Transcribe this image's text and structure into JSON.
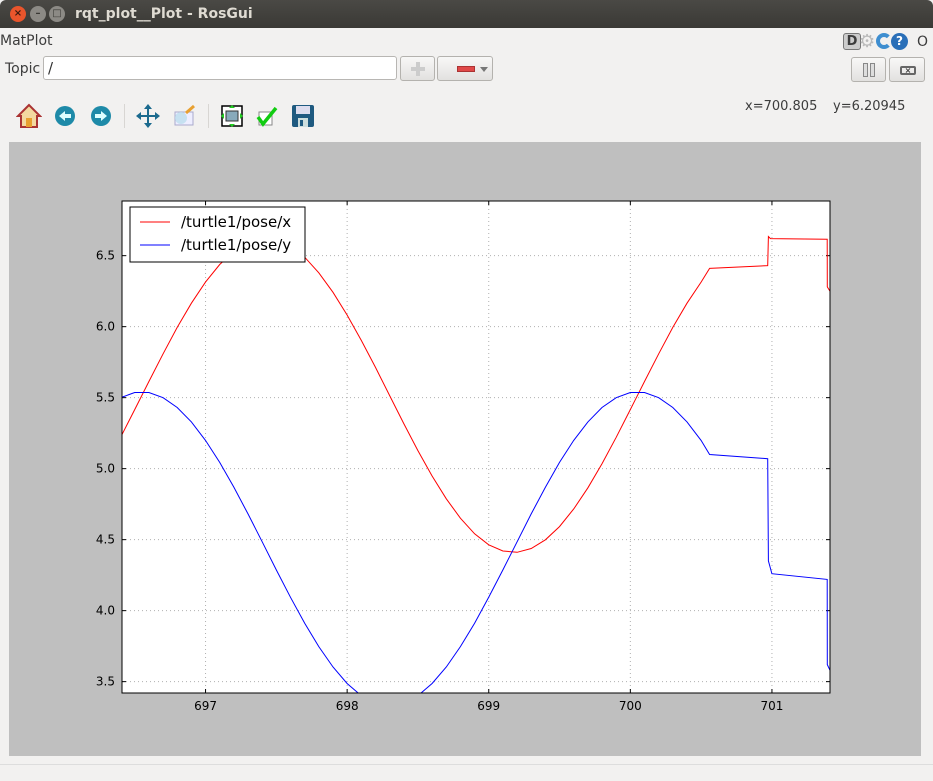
{
  "window": {
    "title": "rqt_plot__Plot - RosGui",
    "close": "×",
    "minimize": "–",
    "maximize": "□"
  },
  "plugin": {
    "title": "MatPlot",
    "header_icons": [
      "d-icon",
      "gear-icon",
      "reload-icon",
      "help-icon"
    ],
    "close_label": "O"
  },
  "topic": {
    "label": "Topic",
    "value": "/"
  },
  "toolbar": {
    "items": [
      "home",
      "back",
      "forward",
      "pan",
      "zoom",
      "configure-subplots",
      "edit-axis",
      "save"
    ]
  },
  "coords": {
    "x": "x=700.805",
    "y": "y=6.20945"
  },
  "colors": {
    "x_series": "#ff0000",
    "y_series": "#0000ff",
    "canvas_bg": "#bfbfbf"
  },
  "chart_data": {
    "type": "line",
    "xlim": [
      696.41,
      701.41
    ],
    "ylim": [
      3.42,
      6.885
    ],
    "xticks": [
      "697",
      "698",
      "699",
      "700",
      "701"
    ],
    "yticks": [
      "3.5",
      "4.0",
      "4.5",
      "5.0",
      "5.5",
      "6.0",
      "6.5"
    ],
    "grid": true,
    "legend_placement": "top-left",
    "series": [
      {
        "name": "/turtle1/pose/x",
        "color": "#ff0000",
        "points": [
          [
            696.4,
            5.221
          ],
          [
            696.5,
            5.416
          ],
          [
            696.6,
            5.614
          ],
          [
            696.7,
            5.809
          ],
          [
            696.8,
            5.995
          ],
          [
            696.9,
            6.165
          ],
          [
            697.0,
            6.314
          ],
          [
            697.1,
            6.438
          ],
          [
            697.2,
            6.531
          ],
          [
            697.3,
            6.592
          ],
          [
            697.4,
            6.619
          ],
          [
            697.5,
            6.61
          ],
          [
            697.6,
            6.566
          ],
          [
            697.7,
            6.489
          ],
          [
            697.8,
            6.379
          ],
          [
            697.9,
            6.242
          ],
          [
            698.0,
            6.082
          ],
          [
            698.1,
            5.903
          ],
          [
            698.2,
            5.713
          ],
          [
            698.3,
            5.515
          ],
          [
            698.4,
            5.317
          ],
          [
            698.5,
            5.127
          ],
          [
            698.6,
            4.948
          ],
          [
            698.7,
            4.788
          ],
          [
            698.8,
            4.651
          ],
          [
            698.9,
            4.541
          ],
          [
            699.0,
            4.464
          ],
          [
            699.1,
            4.42
          ],
          [
            699.2,
            4.411
          ],
          [
            699.3,
            4.438
          ],
          [
            699.4,
            4.499
          ],
          [
            699.5,
            4.592
          ],
          [
            699.6,
            4.716
          ],
          [
            699.7,
            4.865
          ],
          [
            699.8,
            5.035
          ],
          [
            699.9,
            5.221
          ],
          [
            700.0,
            5.416
          ],
          [
            700.1,
            5.614
          ],
          [
            700.2,
            5.809
          ],
          [
            700.3,
            5.995
          ],
          [
            700.4,
            6.165
          ],
          [
            700.5,
            6.314
          ],
          [
            700.56,
            6.41
          ],
          [
            700.97,
            6.43
          ],
          [
            700.975,
            6.635
          ],
          [
            700.99,
            6.62
          ],
          [
            701.39,
            6.615
          ],
          [
            701.391,
            6.28
          ],
          [
            701.41,
            6.25
          ]
        ]
      },
      {
        "name": "/turtle1/pose/y",
        "color": "#0000ff",
        "points": [
          [
            696.4,
            5.5
          ],
          [
            696.5,
            5.536
          ],
          [
            696.6,
            5.536
          ],
          [
            696.7,
            5.5
          ],
          [
            696.8,
            5.431
          ],
          [
            696.9,
            5.329
          ],
          [
            697.0,
            5.199
          ],
          [
            697.1,
            5.044
          ],
          [
            697.2,
            4.869
          ],
          [
            697.3,
            4.681
          ],
          [
            697.4,
            4.485
          ],
          [
            697.5,
            4.287
          ],
          [
            697.6,
            4.094
          ],
          [
            697.7,
            3.911
          ],
          [
            697.8,
            3.747
          ],
          [
            697.9,
            3.603
          ],
          [
            698.0,
            3.487
          ],
          [
            698.1,
            3.401
          ],
          [
            698.2,
            3.348
          ],
          [
            698.3,
            3.33
          ],
          [
            698.4,
            3.348
          ],
          [
            698.5,
            3.401
          ],
          [
            698.6,
            3.487
          ],
          [
            698.7,
            3.603
          ],
          [
            698.8,
            3.747
          ],
          [
            698.9,
            3.911
          ],
          [
            699.0,
            4.094
          ],
          [
            699.1,
            4.287
          ],
          [
            699.2,
            4.485
          ],
          [
            699.3,
            4.681
          ],
          [
            699.4,
            4.869
          ],
          [
            699.5,
            5.044
          ],
          [
            699.6,
            5.199
          ],
          [
            699.7,
            5.329
          ],
          [
            699.8,
            5.431
          ],
          [
            699.9,
            5.5
          ],
          [
            700.0,
            5.536
          ],
          [
            700.1,
            5.536
          ],
          [
            700.2,
            5.5
          ],
          [
            700.3,
            5.431
          ],
          [
            700.4,
            5.329
          ],
          [
            700.5,
            5.199
          ],
          [
            700.56,
            5.1
          ],
          [
            700.97,
            5.07
          ],
          [
            700.975,
            4.35
          ],
          [
            701.0,
            4.26
          ],
          [
            701.39,
            4.22
          ],
          [
            701.391,
            3.62
          ],
          [
            701.41,
            3.58
          ]
        ]
      }
    ]
  }
}
